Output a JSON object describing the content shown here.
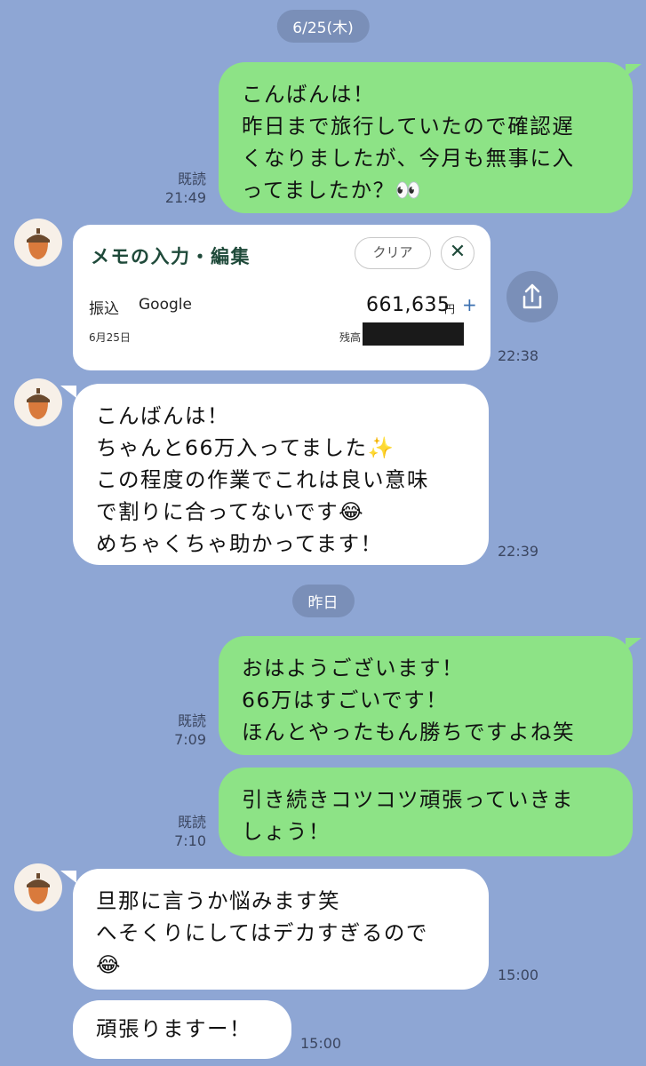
{
  "date_separators": [
    "6/25(木)",
    "昨日"
  ],
  "messages": [
    {
      "side": "me",
      "text": "こんばんは！\n昨日まで旅行していたので確認遅\nくなりましたが、今月も無事に入\nってましたか？👀",
      "read": "既読",
      "time": "21:49"
    },
    {
      "side": "them",
      "card": {
        "title": "メモの入力・編集",
        "clear_label": "クリア",
        "close_label": "✕",
        "type": "振込",
        "payee": "Google",
        "amount": "661,635",
        "currency": "円",
        "plus": "+",
        "date": "6月25日",
        "balance_label": "残高"
      },
      "time": "22:38"
    },
    {
      "side": "them",
      "text": "こんばんは！\nちゃんと66万入ってました✨\nこの程度の作業でこれは良い意味\nで割りに合ってないです😂\nめちゃくちゃ助かってます！",
      "time": "22:39"
    },
    {
      "side": "me",
      "text": "おはようございます！\n66万はすごいです！\nほんとやったもん勝ちですよね笑",
      "read": "既読",
      "time": "7:09"
    },
    {
      "side": "me",
      "text": "引き続きコツコツ頑張っていきま\nしょう！",
      "read": "既読",
      "time": "7:10"
    },
    {
      "side": "them",
      "text": "旦那に言うか悩みます笑\nへそくりにしてはデカすぎるので\n😂",
      "time": "15:00"
    },
    {
      "side": "them",
      "text": "頑張りますー！",
      "time": "15:00"
    }
  ],
  "icons": {
    "avatar": "acorn-icon",
    "share": "share-icon"
  },
  "colors": {
    "background": "#8ea6d4",
    "my_bubble": "#8de386",
    "their_bubble": "#ffffff"
  }
}
